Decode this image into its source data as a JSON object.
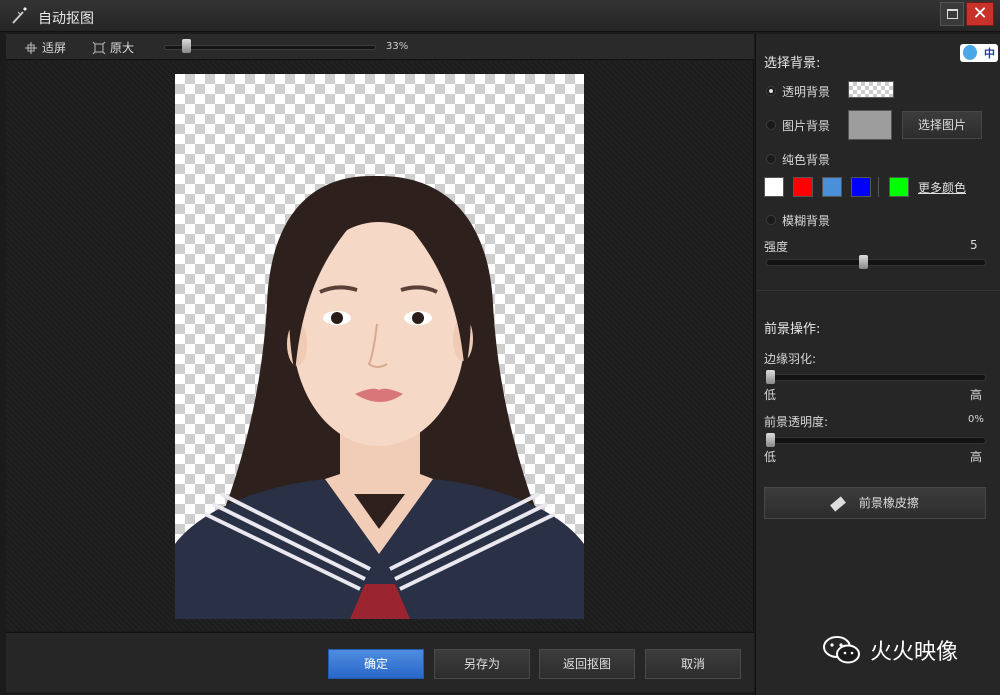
{
  "window": {
    "title": "自动抠图"
  },
  "toolbar": {
    "fit_label": "适屏",
    "original_label": "原大",
    "zoom_value": "33%",
    "zoom_fraction": 0.1
  },
  "panel": {
    "bg_heading": "选择背景:",
    "transparent_label": "透明背景",
    "image_label": "图片背景",
    "choose_image_label": "选择图片",
    "solid_label": "纯色背景",
    "more_colors_label": "更多颜色",
    "blur_label": "模糊背景",
    "strength_label": "强度",
    "strength_value": "5",
    "fg_heading": "前景操作:",
    "feather_label": "边缘羽化:",
    "low_label": "低",
    "high_label": "高",
    "opacity_label": "前景透明度:",
    "opacity_value": "0%",
    "eraser_label": "前景橡皮擦",
    "selected_background": "transparent",
    "swatch_colors": [
      "#ffffff",
      "#ff0000",
      "#4a90d9",
      "#0000ff",
      "#00ff00"
    ]
  },
  "ime": {
    "label": "中"
  },
  "buttons": {
    "ok": "确定",
    "save_as": "另存为",
    "back": "返回抠图",
    "cancel": "取消"
  },
  "watermark": {
    "text": "火火映像"
  }
}
